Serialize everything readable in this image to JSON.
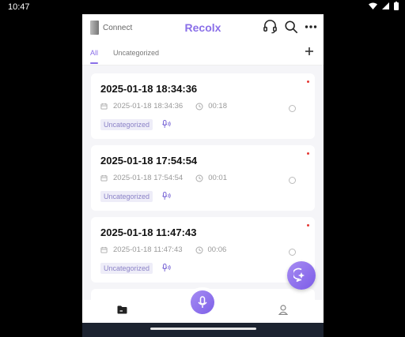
{
  "status_bar": {
    "time": "10:47"
  },
  "header": {
    "connect_label": "Connect",
    "brand": "Recolx"
  },
  "tabs": [
    {
      "label": "All",
      "active": true
    },
    {
      "label": "Uncategorized",
      "active": false
    }
  ],
  "recordings": [
    {
      "title": "2025-01-18 18:34:36",
      "datetime": "2025-01-18 18:34:36",
      "duration": "00:18",
      "category": "Uncategorized"
    },
    {
      "title": "2025-01-18 17:54:54",
      "datetime": "2025-01-18 17:54:54",
      "duration": "00:01",
      "category": "Uncategorized"
    },
    {
      "title": "2025-01-18 11:47:43",
      "datetime": "2025-01-18 11:47:43",
      "duration": "00:06",
      "category": "Uncategorized"
    }
  ],
  "colors": {
    "accent": "#8a6fe8",
    "unread_dot": "#e53935",
    "tag_bg": "#eeedf8"
  },
  "icons": [
    "headset-icon",
    "search-icon",
    "more-icon",
    "add-icon",
    "calendar-icon",
    "clock-icon",
    "speaker-icon",
    "ai-assistant-icon",
    "mic-icon",
    "folder-icon",
    "user-icon"
  ]
}
